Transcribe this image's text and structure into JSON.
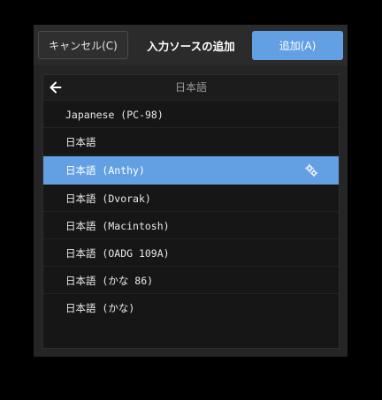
{
  "header": {
    "cancel_label": "キャンセル(C)",
    "title": "入力ソースの追加",
    "add_label": "追加(A)"
  },
  "list": {
    "title": "日本語",
    "items": [
      {
        "label": "Japanese (PC-98)"
      },
      {
        "label": "日本語"
      },
      {
        "label": "日本語 (Anthy)",
        "selected": true
      },
      {
        "label": "日本語 (Dvorak)"
      },
      {
        "label": "日本語 (Macintosh)"
      },
      {
        "label": "日本語 (OADG 109A)"
      },
      {
        "label": "日本語 (かな 86)"
      },
      {
        "label": "日本語 (かな)"
      }
    ]
  },
  "colors": {
    "accent": "#62a0e3",
    "background": "#000000",
    "dialog": "#2b2b2b",
    "panel": "#161616"
  },
  "icons": {
    "back": "arrow-left-icon",
    "settings": "gear-icon"
  }
}
